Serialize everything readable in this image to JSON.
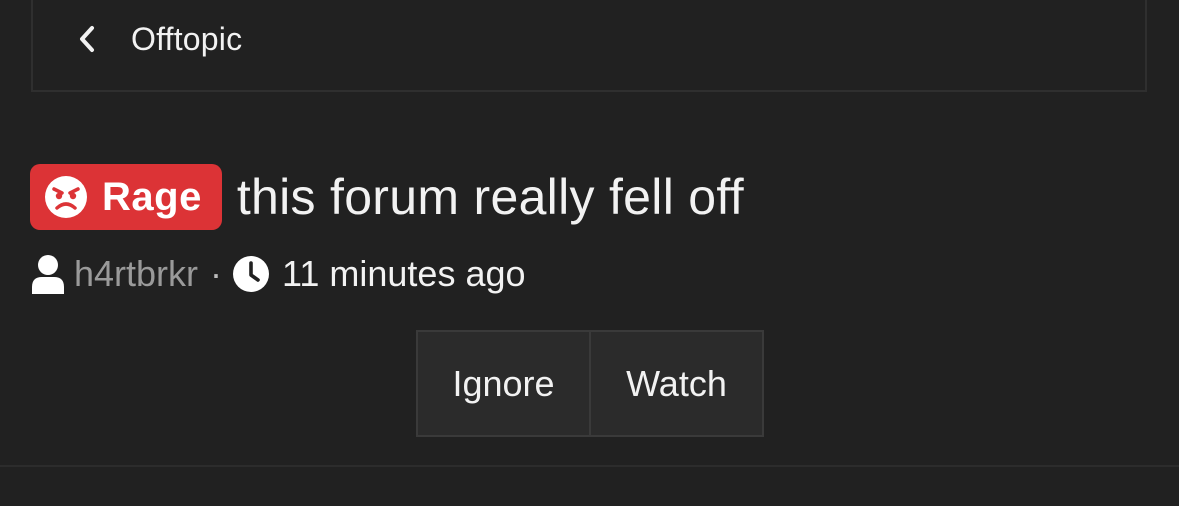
{
  "breadcrumb": {
    "icon": "chevron-left-icon",
    "label": "Offtopic"
  },
  "thread": {
    "badge": {
      "icon": "angry-face-icon",
      "label": "Rage",
      "color": "#dc3336"
    },
    "title": "this forum really fell off"
  },
  "meta": {
    "user_icon": "user-icon",
    "username": "h4rtbrkr",
    "separator": "·",
    "clock_icon": "clock-icon",
    "timestamp": "11 minutes ago"
  },
  "actions": {
    "ignore_label": "Ignore",
    "watch_label": "Watch"
  },
  "colors": {
    "background": "#212121",
    "text": "#f2f2f2",
    "muted": "#9a9a9a",
    "button_bg": "#2b2b2b"
  }
}
